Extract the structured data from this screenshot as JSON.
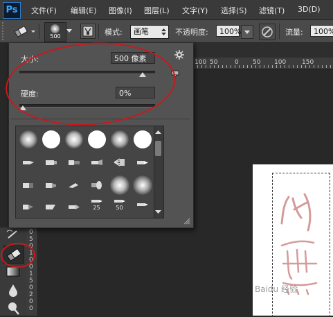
{
  "app": {
    "logo": "Ps"
  },
  "menu": [
    "文件(F)",
    "编辑(E)",
    "图像(I)",
    "图层(L)",
    "文字(Y)",
    "选择(S)",
    "滤镜(T)",
    "3D(D)"
  ],
  "options": {
    "brush_size": "500",
    "mode_label": "模式:",
    "mode_value": "画笔",
    "opacity_label": "不透明度:",
    "opacity_value": "100%",
    "flow_label": "流量:",
    "flow_value": "100%"
  },
  "brush_panel": {
    "size_label": "大小:",
    "size_value": "500 像素",
    "size_fraction": 1.0,
    "hardness_label": "硬度:",
    "hardness_value": "0%",
    "hardness_fraction": 0.0,
    "preset_labels": [
      "25",
      "50"
    ]
  },
  "rulers": {
    "top": [
      "100",
      "50",
      "0",
      "50",
      "100",
      "150"
    ],
    "left": [
      "0",
      "5",
      "0",
      "1",
      "0",
      "0",
      "1",
      "5",
      "0",
      "2",
      "0",
      "0"
    ]
  },
  "colors": {
    "annotation": "#c8191c",
    "panel_bg": "#535353",
    "menubar_bg": "#3a3a3a",
    "signature": "#d69a9a"
  },
  "watermark": "Baidu 经验"
}
